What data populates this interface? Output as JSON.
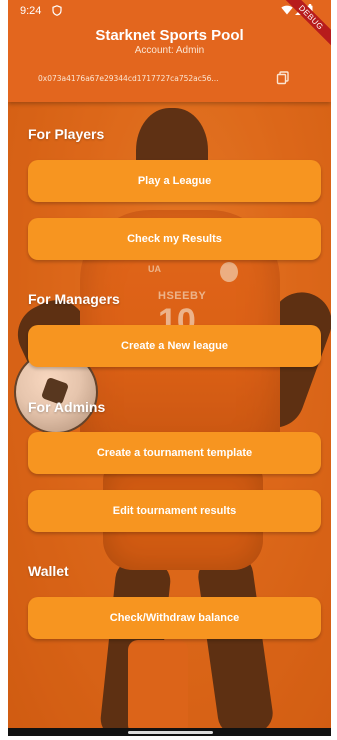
{
  "status_bar": {
    "time": "9:24"
  },
  "debug_banner": "DEBUG",
  "app_bar": {
    "title": "Starknet Sports Pool",
    "subtitle": "Account: Admin",
    "address": "0x073a4176a67e29344cd1717727ca752ac56..."
  },
  "sections": {
    "players": {
      "title": "For Players",
      "buttons": [
        "Play a League",
        "Check my Results"
      ]
    },
    "managers": {
      "title": "For Managers",
      "buttons": [
        "Create a New league"
      ]
    },
    "admins": {
      "title": "For Admins",
      "buttons": [
        "Create a tournament template",
        "Edit tournament results"
      ]
    },
    "wallet": {
      "title": "Wallet",
      "buttons": [
        "Check/Withdraw balance"
      ]
    }
  },
  "background": {
    "jersey_name": "HSEEBY",
    "jersey_number": "10",
    "brand": "UA"
  },
  "colors": {
    "app_bar": "#e3661e",
    "button": "#f79520",
    "background": "#d9651a",
    "debug_ribbon": "#b71c1c"
  }
}
